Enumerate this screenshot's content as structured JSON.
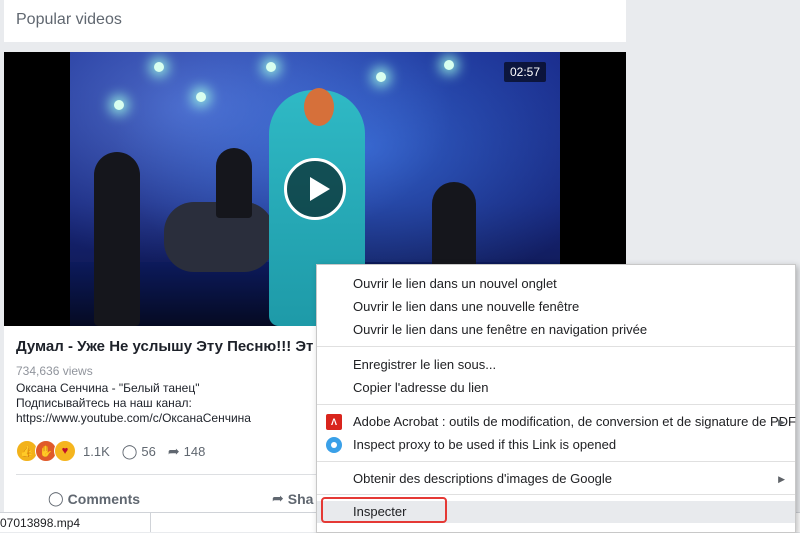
{
  "header": {
    "title": "Popular videos"
  },
  "video": {
    "duration": "02:57",
    "title": "Думал - Уже Не услышу Эту Песню!!! Эт",
    "views": "734,636 views",
    "description_lines": [
      "Оксана Сенчина - \"Белый танец\"",
      "Подписывайтесь на наш канал:",
      "https://www.youtube.com/c/ОксанаСенчина"
    ],
    "reaction_count": "1.1K",
    "comments_count": "56",
    "shares_count": "148"
  },
  "actions": {
    "comments_label": "Comments",
    "share_label": "Sha"
  },
  "download_bar": {
    "file_name": "07013898.mp4"
  },
  "context_menu": {
    "items": [
      {
        "label": "Ouvrir le lien dans un nouvel onglet"
      },
      {
        "label": "Ouvrir le lien dans une nouvelle fenêtre"
      },
      {
        "label": "Ouvrir le lien dans une fenêtre en navigation privée"
      },
      {
        "label": "Enregistrer le lien sous..."
      },
      {
        "label": "Copier l'adresse du lien"
      },
      {
        "label": "Adobe Acrobat : outils de modification, de conversion et de signature de PDF",
        "icon": "adobe-acrobat-icon",
        "submenu": true
      },
      {
        "label": "Inspect proxy to be used if this Link is opened",
        "icon": "proxy-icon"
      },
      {
        "label": "Obtenir des descriptions d'images de Google",
        "submenu": true
      },
      {
        "label": "Inspecter",
        "highlighted": true
      }
    ],
    "highlight_color": "#e53935"
  }
}
